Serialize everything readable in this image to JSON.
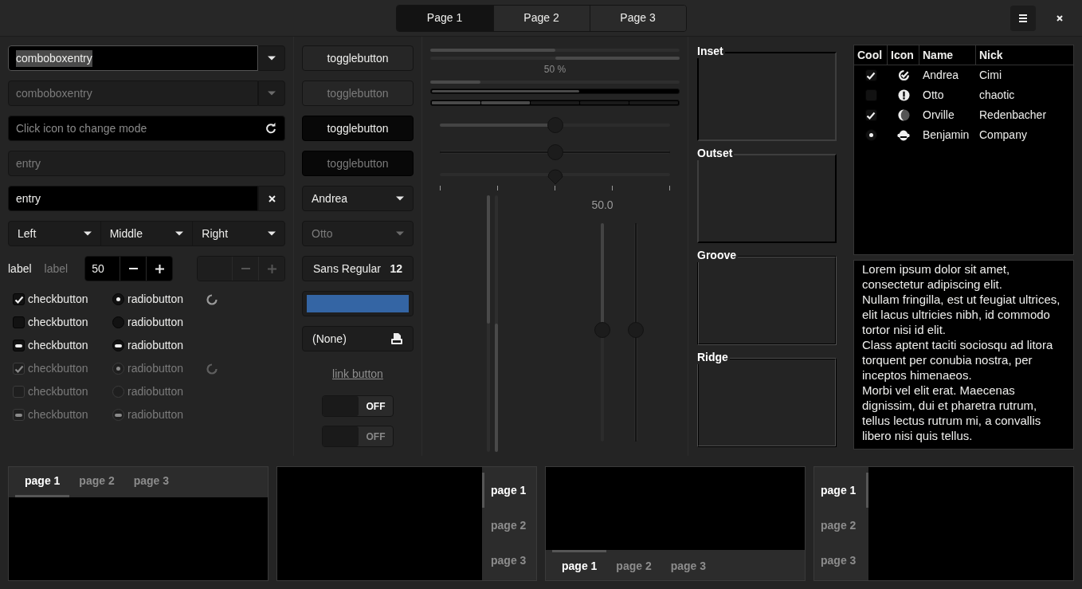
{
  "header": {
    "tabs": [
      {
        "label": "Page 1",
        "selected": true
      },
      {
        "label": "Page 2",
        "selected": false
      },
      {
        "label": "Page 3",
        "selected": false
      }
    ]
  },
  "entries": [
    {
      "kind": "combo",
      "value": "comboboxentry",
      "disabled": false,
      "focused": true,
      "text_selected": true
    },
    {
      "kind": "combo",
      "value": "comboboxentry",
      "disabled": true,
      "focused": false
    },
    {
      "kind": "icon",
      "placeholder": "Click icon to change mode",
      "disabled": false,
      "focused": false
    },
    {
      "kind": "plain",
      "value": "entry",
      "disabled": true,
      "focused": false
    },
    {
      "kind": "clear",
      "value": "entry",
      "disabled": false,
      "focused": false
    }
  ],
  "linked_combos": [
    {
      "label": "Left"
    },
    {
      "label": "Middle"
    },
    {
      "label": "Right"
    }
  ],
  "labels": [
    {
      "text": "label",
      "disabled": false
    },
    {
      "text": "label",
      "disabled": true
    }
  ],
  "spin_buttons": [
    {
      "value": "50",
      "disabled": false
    },
    {
      "disabled": true
    }
  ],
  "check_buttons": [
    {
      "label": "checkbutton",
      "checked": true,
      "inconsistent": false,
      "disabled": false
    },
    {
      "label": "checkbutton",
      "checked": false,
      "inconsistent": false,
      "disabled": false
    },
    {
      "label": "checkbutton",
      "checked": false,
      "inconsistent": true,
      "disabled": false
    },
    {
      "label": "checkbutton",
      "checked": true,
      "inconsistent": false,
      "disabled": true
    },
    {
      "label": "checkbutton",
      "checked": false,
      "inconsistent": false,
      "disabled": true
    },
    {
      "label": "checkbutton",
      "checked": false,
      "inconsistent": true,
      "disabled": true
    }
  ],
  "radio_buttons": [
    {
      "label": "radiobutton",
      "checked": true,
      "inconsistent": false,
      "disabled": false
    },
    {
      "label": "radiobutton",
      "checked": false,
      "inconsistent": false,
      "disabled": false
    },
    {
      "label": "radiobutton",
      "checked": false,
      "inconsistent": true,
      "disabled": false
    },
    {
      "label": "radiobutton",
      "checked": true,
      "inconsistent": false,
      "disabled": true
    },
    {
      "label": "radiobutton",
      "checked": false,
      "inconsistent": false,
      "disabled": true
    },
    {
      "label": "radiobutton",
      "checked": false,
      "inconsistent": true,
      "disabled": true
    }
  ],
  "spinners": [
    {
      "disabled": false
    },
    {
      "disabled": true
    }
  ],
  "toggle_buttons": [
    {
      "label": "togglebutton",
      "active": false,
      "disabled": false
    },
    {
      "label": "togglebutton",
      "active": false,
      "disabled": true
    },
    {
      "label": "togglebutton",
      "active": true,
      "disabled": false
    },
    {
      "label": "togglebutton",
      "active": true,
      "disabled": true
    }
  ],
  "combo_boxes": [
    {
      "value": "Andrea",
      "disabled": false
    },
    {
      "value": "Otto",
      "disabled": true
    }
  ],
  "font_button": {
    "family": "Sans Regular",
    "size": "12"
  },
  "color_button": {
    "color": "#3465a4"
  },
  "file_button": {
    "label": "(None)"
  },
  "link_button": {
    "label": "link button"
  },
  "switches": [
    {
      "label": "OFF",
      "on": false,
      "disabled": false
    },
    {
      "label": "OFF",
      "on": false,
      "disabled": true
    }
  ],
  "bars": [
    {
      "kind": "progress",
      "level": 0.5
    },
    {
      "kind": "progress-inverted",
      "level": 0.5
    },
    {
      "kind": "label",
      "text": "50 %"
    },
    {
      "kind": "progress",
      "level": 0.2
    },
    {
      "kind": "levelbar",
      "level": 0.6
    },
    {
      "kind": "segmented",
      "level": 0.4
    }
  ],
  "sliders": [
    {
      "kind": "fill",
      "level": 0.5
    },
    {
      "kind": "plain",
      "level": 0.5
    },
    {
      "kind": "marks",
      "level": 0.5
    }
  ],
  "vertical_progress": [
    {
      "kind": "from-top",
      "level": 0.5
    },
    {
      "kind": "from-bottom",
      "level": 0.5
    }
  ],
  "vertical_scales": [
    {
      "kind": "fill",
      "level": 0.49,
      "value": "50.0"
    },
    {
      "kind": "plain",
      "level": 0.49
    }
  ],
  "frames": [
    {
      "label": "Inset",
      "kind": "inset"
    },
    {
      "label": "Outset",
      "kind": "outset"
    },
    {
      "label": "Groove",
      "kind": "groove"
    },
    {
      "label": "Ridge",
      "kind": "ridge"
    }
  ],
  "tree": {
    "columns": [
      "Cool",
      "Icon",
      "Name",
      "Nick"
    ],
    "rows": [
      {
        "kind": "check",
        "checked": true,
        "name": "Andrea",
        "nick": "Cimi"
      },
      {
        "kind": "check",
        "checked": false,
        "name": "Otto",
        "nick": "chaotic"
      },
      {
        "kind": "check",
        "checked": true,
        "name": "Orville",
        "nick": "Redenbacher"
      },
      {
        "kind": "radio",
        "checked": true,
        "name": "Benjamin",
        "nick": "Company"
      }
    ]
  },
  "text_view": {
    "paragraphs": [
      "Lorem ipsum dolor sit amet, consectetur adipiscing elit.",
      "Nullam fringilla, est ut feugiat ultrices, elit lacus ultricies nibh, id commodo tortor nisi id elit.",
      "Class aptent taciti sociosqu ad litora torquent per conubia nostra, per inceptos himenaeos.",
      "Morbi vel elit erat. Maecenas dignissim, dui et pharetra rutrum, tellus lectus rutrum mi, a convallis libero nisi quis tellus."
    ]
  },
  "notebooks": [
    {
      "kind": "top",
      "tabs": [
        {
          "label": "page 1",
          "selected": true
        },
        {
          "label": "page 2",
          "selected": false
        },
        {
          "label": "page 3",
          "selected": false
        }
      ]
    },
    {
      "kind": "right",
      "tabs": [
        {
          "label": "page 1",
          "selected": true
        },
        {
          "label": "page 2",
          "selected": false
        },
        {
          "label": "page 3",
          "selected": false
        }
      ]
    },
    {
      "kind": "bottom",
      "tabs": [
        {
          "label": "page 1",
          "selected": true
        },
        {
          "label": "page 2",
          "selected": false
        },
        {
          "label": "page 3",
          "selected": false
        }
      ]
    },
    {
      "kind": "left",
      "tabs": [
        {
          "label": "page 1",
          "selected": true
        },
        {
          "label": "page 2",
          "selected": false
        },
        {
          "label": "page 3",
          "selected": false
        }
      ]
    }
  ]
}
